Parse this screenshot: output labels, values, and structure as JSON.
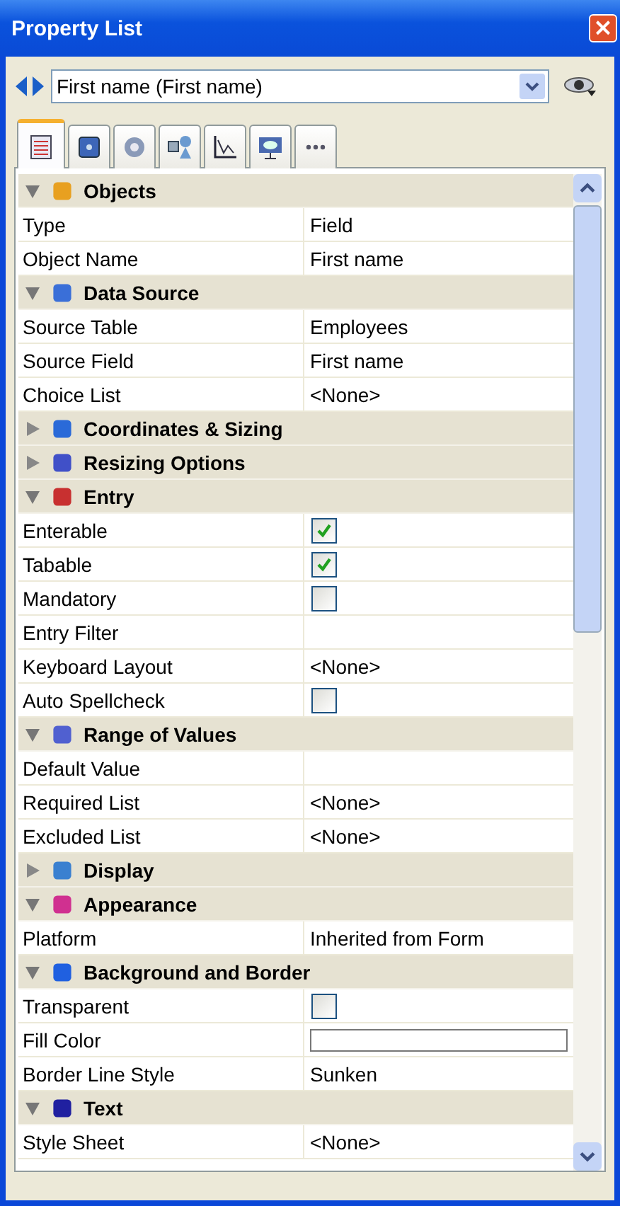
{
  "window": {
    "title": "Property List",
    "close": "×"
  },
  "object_selector": {
    "value": "First name (First name)"
  },
  "tabs": [
    {
      "selected": true
    },
    {
      "selected": false
    },
    {
      "selected": false
    },
    {
      "selected": false
    },
    {
      "selected": false
    },
    {
      "selected": false
    },
    {
      "selected": false
    }
  ],
  "sections": [
    {
      "title": "Objects",
      "expanded": true,
      "rows": [
        {
          "label": "Type",
          "kind": "text",
          "value": "Field"
        },
        {
          "label": "Object Name",
          "kind": "text",
          "value": "First name"
        }
      ]
    },
    {
      "title": "Data Source",
      "expanded": true,
      "rows": [
        {
          "label": "Source Table",
          "kind": "text",
          "value": "Employees"
        },
        {
          "label": "Source Field",
          "kind": "text",
          "value": "First name"
        },
        {
          "label": "Choice List",
          "kind": "text",
          "value": "<None>"
        }
      ]
    },
    {
      "title": "Coordinates & Sizing",
      "expanded": false
    },
    {
      "title": "Resizing Options",
      "expanded": false
    },
    {
      "title": "Entry",
      "expanded": true,
      "rows": [
        {
          "label": "Enterable",
          "kind": "checkbox",
          "checked": true
        },
        {
          "label": "Tabable",
          "kind": "checkbox",
          "checked": true
        },
        {
          "label": "Mandatory",
          "kind": "checkbox",
          "checked": false
        },
        {
          "label": "Entry Filter",
          "kind": "text"
        },
        {
          "label": "Keyboard Layout",
          "kind": "text",
          "value": "<None>"
        },
        {
          "label": "Auto Spellcheck",
          "kind": "checkbox",
          "checked": false
        }
      ]
    },
    {
      "title": "Range of Values",
      "expanded": true,
      "rows": [
        {
          "label": "Default Value",
          "kind": "text"
        },
        {
          "label": "Required List",
          "kind": "text",
          "value": "<None>"
        },
        {
          "label": "Excluded List",
          "kind": "text",
          "value": "<None>"
        }
      ]
    },
    {
      "title": "Display",
      "expanded": false
    },
    {
      "title": "Appearance",
      "expanded": true,
      "rows": [
        {
          "label": "Platform",
          "kind": "text",
          "value": "Inherited from Form"
        }
      ]
    },
    {
      "title": "Background and Border",
      "expanded": true,
      "rows": [
        {
          "label": "Transparent",
          "kind": "checkbox",
          "checked": false
        },
        {
          "label": "Fill Color",
          "kind": "swatch"
        },
        {
          "label": "Border Line Style",
          "kind": "text",
          "value": "Sunken"
        }
      ]
    },
    {
      "title": "Text",
      "expanded": true,
      "rows": [
        {
          "label": "Style Sheet",
          "kind": "text",
          "value": "<None>"
        }
      ]
    }
  ]
}
